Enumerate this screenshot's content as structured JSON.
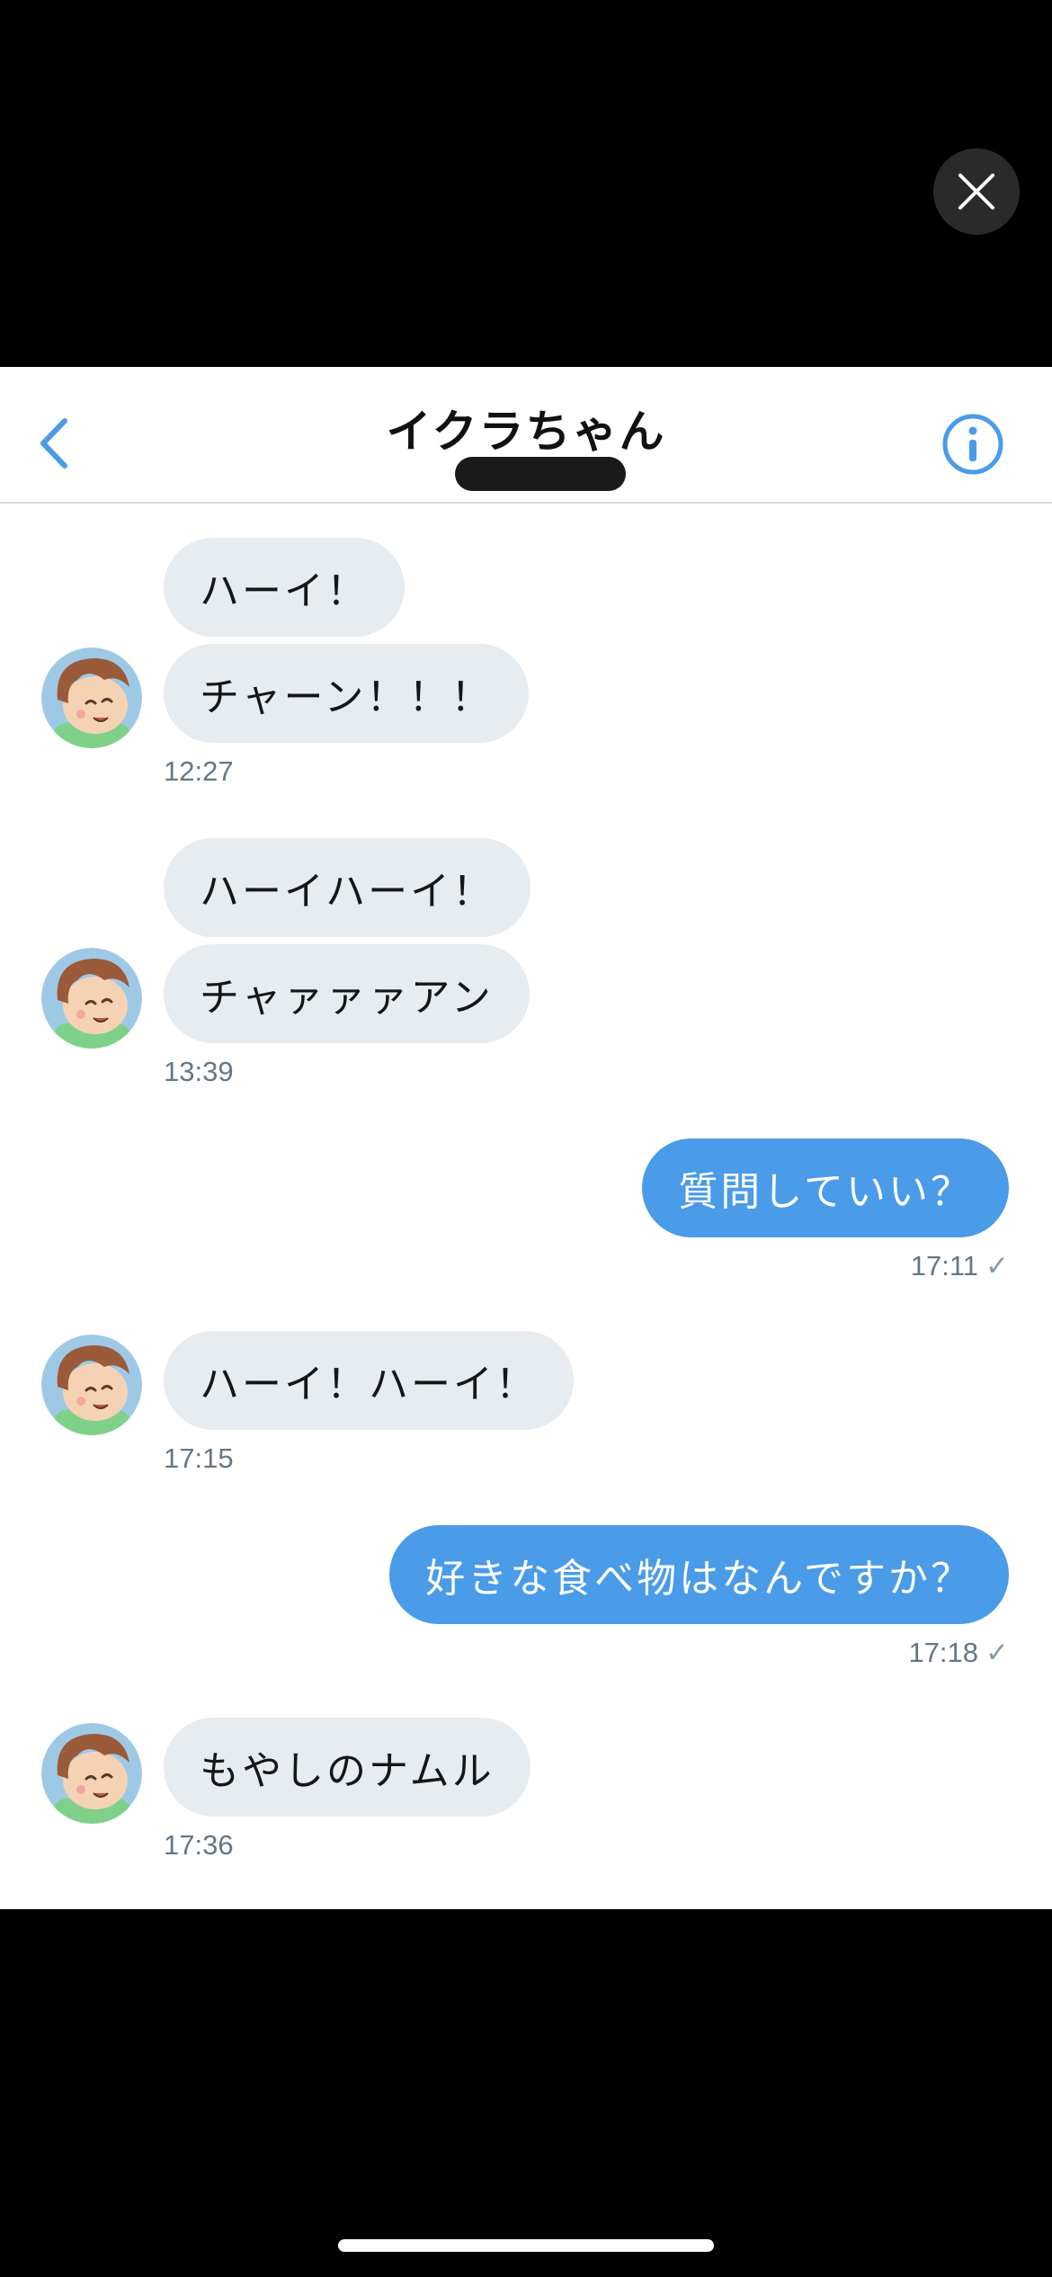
{
  "viewer": {
    "close_icon": "close-icon"
  },
  "chat": {
    "title": "イクラちゃん",
    "back_icon": "chevron-left-icon",
    "info_icon": "info-icon",
    "accent": "#4a9be8"
  },
  "groups": [
    {
      "side": "in",
      "messages": [
        "ハーイ！",
        "チャーン！！！"
      ],
      "time": "12:27"
    },
    {
      "side": "in",
      "messages": [
        "ハーイハーイ！",
        "チャァァァアン"
      ],
      "time": "13:39"
    },
    {
      "side": "out",
      "messages": [
        "質問していい？"
      ],
      "time": "17:11",
      "check": "✓"
    },
    {
      "side": "in",
      "messages": [
        "ハーイ！ハーイ！"
      ],
      "time": "17:15"
    },
    {
      "side": "out",
      "messages": [
        "好きな食べ物はなんですか？"
      ],
      "time": "17:18",
      "check": "✓"
    },
    {
      "side": "in",
      "messages": [
        "もやしのナムル"
      ],
      "time": "17:36"
    }
  ]
}
